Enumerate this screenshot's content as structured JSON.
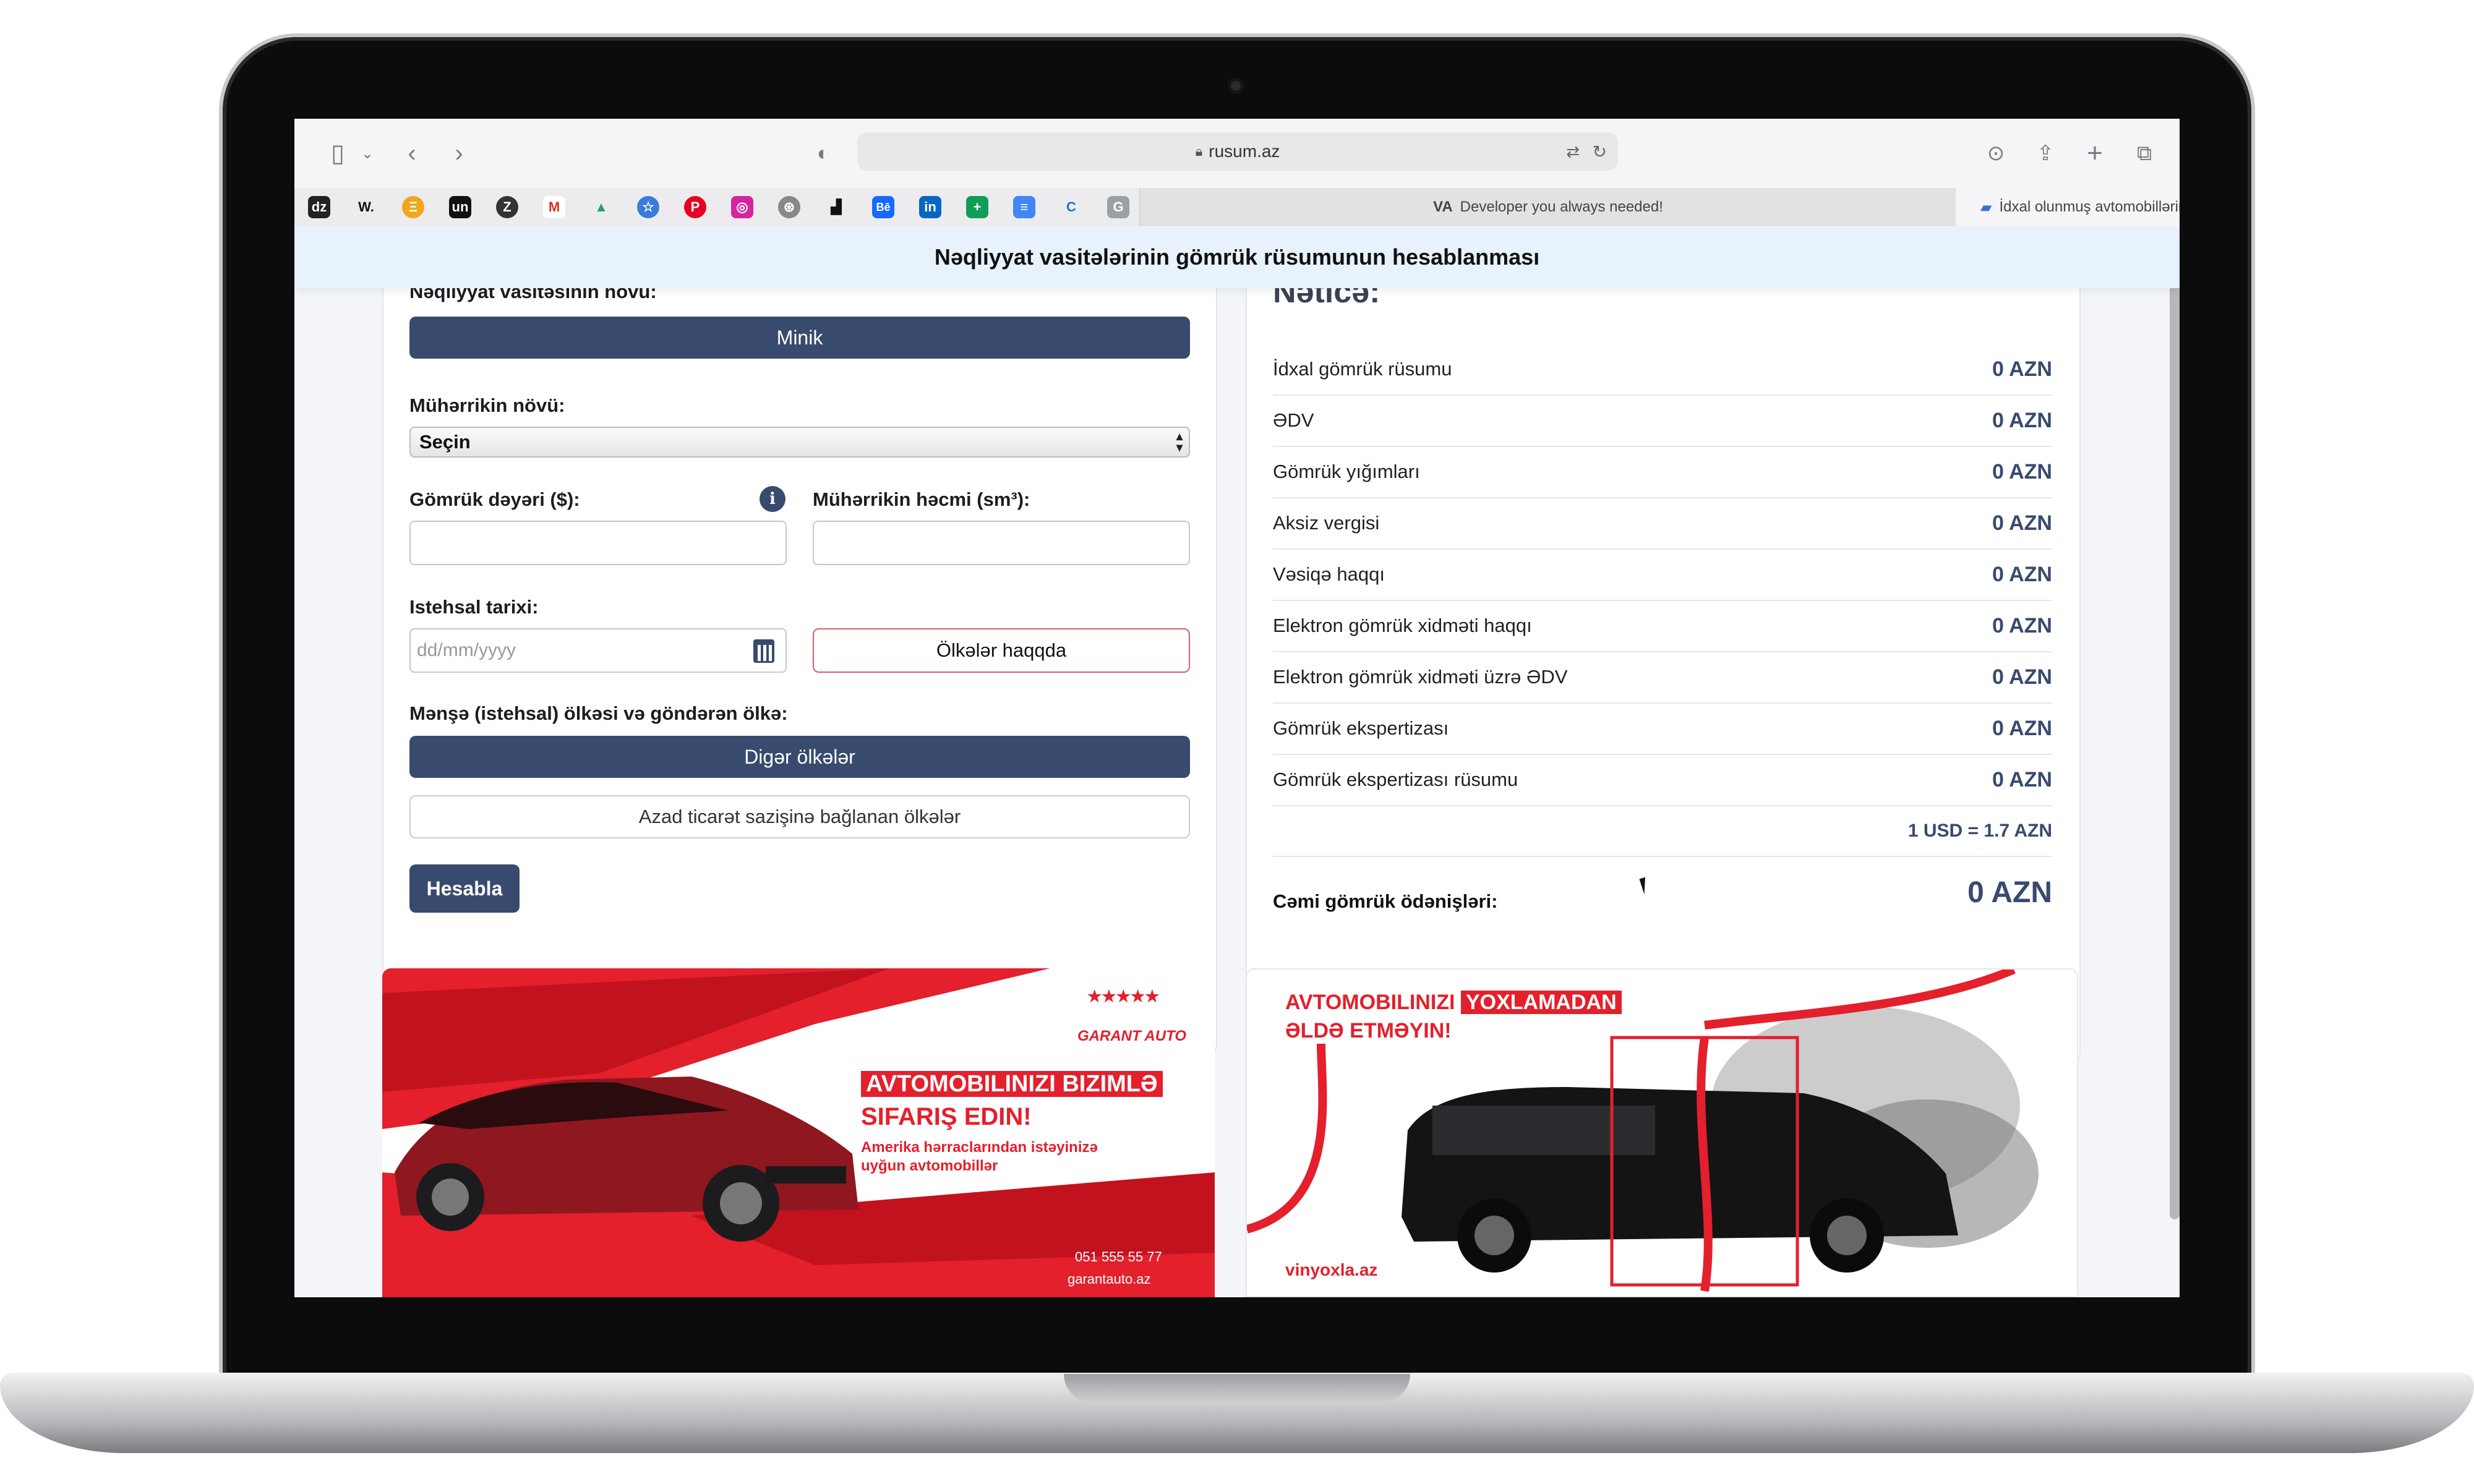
{
  "browser": {
    "url": "rusum.az",
    "tabs": [
      {
        "label": "Developer you always needed!",
        "badge": "VA"
      },
      {
        "label": "İdxal olunmuş avtomobillərin gömrük rüsumunun hesablanması"
      }
    ],
    "bookmarks": [
      "dz",
      "W.",
      "Ξ",
      "un",
      "Z",
      "M",
      "▲",
      "☆",
      "P",
      "◎",
      "⊛",
      "▟",
      "Bē",
      "in",
      "+",
      "≡",
      "C",
      "G"
    ]
  },
  "page": {
    "header": "Nəqliyyat vasitələrinin gömrük rüsumunun hesablanması"
  },
  "form": {
    "vehicle_type_label": "Nəqliyyat vasitəsinin növü:",
    "vehicle_type_value": "Minik",
    "engine_type_label": "Mühərrikin növü:",
    "engine_type_value": "Seçin",
    "customs_value_label": "Gömrük dəyəri ($):",
    "engine_volume_label": "Mühərrikin həcmi (sm³):",
    "production_date_label": "Istehsal tarixi:",
    "production_date_placeholder": "dd/mm/yyyy",
    "countries_info_button": "Ölkələr haqqda",
    "origin_label": "Mənşə (istehsal) ölkəsi və göndərən ölkə:",
    "other_countries_button": "Digər ölkələr",
    "fta_countries_button": "Azad ticarət sazişinə bağlanan ölkələr",
    "calculate_button": "Hesabla"
  },
  "result": {
    "title": "Nəticə:",
    "rows": [
      {
        "label": "İdxal gömrük rüsumu",
        "value": "0 AZN"
      },
      {
        "label": "ƏDV",
        "value": "0 AZN"
      },
      {
        "label": "Gömrük yığımları",
        "value": "0 AZN"
      },
      {
        "label": "Aksiz vergisi",
        "value": "0 AZN"
      },
      {
        "label": "Vəsiqə haqqı",
        "value": "0 AZN"
      },
      {
        "label": "Elektron gömrük xidməti haqqı",
        "value": "0 AZN"
      },
      {
        "label": "Elektron gömrük xidməti üzrə ƏDV",
        "value": "0 AZN"
      },
      {
        "label": "Gömrük ekspertizası",
        "value": "0 AZN"
      },
      {
        "label": "Gömrük ekspertizası rüsumu",
        "value": "0 AZN"
      }
    ],
    "rate": "1 USD = 1.7 AZN",
    "total_label": "Cəmi gömrük ödənişləri:",
    "total_value": "0 AZN"
  },
  "banners": {
    "left": {
      "logo": "GARANT AUTO",
      "headline_1": "AVTOMOBILINIZI BIZIMLƏ",
      "headline_2": "SIFARIŞ EDIN!",
      "sub_1": "Amerika hərraclarından istəyinizə",
      "sub_2": "uyğun avtomobillər",
      "phone": "051 555 55 77",
      "site": "garantauto.az"
    },
    "right": {
      "headline_1": "AVTOMOBILINIZI",
      "headline_hl": "YOXLAMADAN",
      "headline_2": "ƏLDƏ ETMƏYIN!",
      "site": "vinyoxla.az"
    }
  },
  "colors": {
    "primary": "#384a6e",
    "danger_border": "#e05b66",
    "banner_red": "#e3202c",
    "header_bg": "#e8f2fc"
  }
}
